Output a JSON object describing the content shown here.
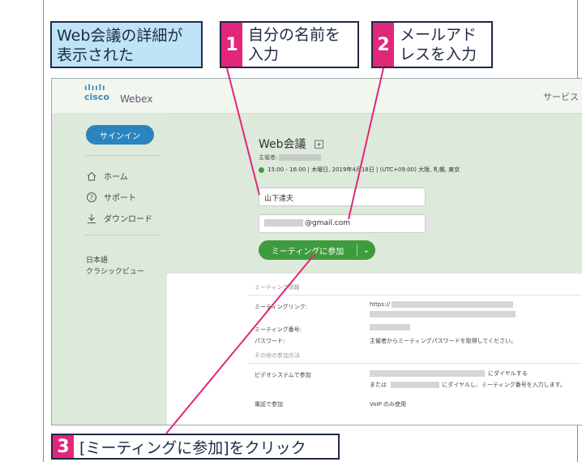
{
  "callouts": {
    "info": "Web会議の詳細が\n表示された",
    "step1": {
      "num": "1",
      "text": "自分の名前を\n入力"
    },
    "step2": {
      "num": "2",
      "text": "メールアド\nレスを入力"
    },
    "step3": {
      "num": "3",
      "text": "[ミーティングに参加]をクリック"
    }
  },
  "header": {
    "logo_mark": "ılıılı",
    "logo_cisco": "cisco",
    "logo_webex": "Webex",
    "service_text": "サービス"
  },
  "sidebar": {
    "signin_label": "サインイン",
    "items": [
      {
        "icon": "home-icon",
        "label": "ホーム"
      },
      {
        "icon": "help-icon",
        "label": "サポート"
      },
      {
        "icon": "download-icon",
        "label": "ダウンロード"
      }
    ],
    "language": "日本語",
    "classic_view": "クラシックビュー"
  },
  "meeting": {
    "title": "Web会議",
    "host_label": "主催者:",
    "time": "15:00 - 16:00 | 木曜日, 2019年4月18日 | (UTC+09:00) 大阪, 札幌, 東京",
    "name_value": "山下達夫",
    "email_value": "@gmail.com",
    "join_label": "ミーティングに参加"
  },
  "details": {
    "section_info": "ミーティング情報",
    "link_label": "ミーティングリンク:",
    "link_value": "https://",
    "number_label": "ミーティング番号:",
    "password_label": "パスワード:",
    "password_value": "主催者からミーティングパスワードを取得してください。",
    "section_other": "その他の参加方法",
    "video_label": "ビデオシステムで参加",
    "video_value1": "にダイヤルする",
    "video_value2_prefix": "または",
    "video_value2_suffix": "にダイヤルし、ミーティング番号を入力します。",
    "phone_label": "電話で参加",
    "phone_value": "VoIP のみ使用"
  },
  "colors": {
    "accent_pink": "#e2267a",
    "callout_blue": "#bfe3f7",
    "join_green": "#3e9c3e",
    "signin_blue": "#2a84c0"
  }
}
